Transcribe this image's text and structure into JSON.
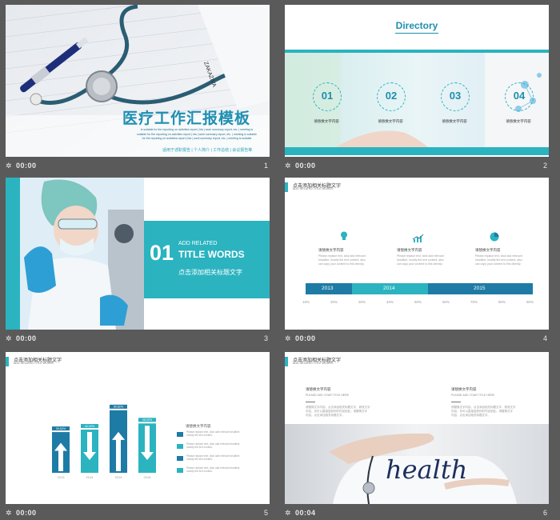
{
  "slides": [
    {
      "index": "1",
      "time": "00:00",
      "title": "医疗工作汇报模板",
      "desc": [
        "is suitable for the reporting on activities report | bla | work summary report, etc. | meeting is",
        "suitable for the reporting on activities report | bla | work summary report, etc. | meeting is suitable",
        "for the reporting on activities report | bla | work summary report, etc. | meeting is suitable"
      ],
      "subtitle": "适用于述职报告 | 个人简介 | 工作总结 | 会议报告等",
      "paper_text": "ZAKAZIVA"
    },
    {
      "index": "2",
      "time": "00:00",
      "title": "Directory",
      "items": [
        {
          "num": "01",
          "label": "请替换文字内容"
        },
        {
          "num": "02",
          "label": "请替换文字内容"
        },
        {
          "num": "03",
          "label": "请替换文字内容"
        },
        {
          "num": "04",
          "label": "请替换文字内容"
        }
      ]
    },
    {
      "index": "3",
      "time": "00:00",
      "number": "01",
      "add_related": "ADD RELATED",
      "title_words": "TITLE WORDS",
      "cn_title": "点击添加相关标题文字"
    },
    {
      "index": "4",
      "time": "00:00",
      "header": "点击添加相关标题文字",
      "subheader": "ADD RELATED TITLE WORDS",
      "icons": [
        {
          "icon": "lightbulb-icon",
          "label": "请替换文字内容"
        },
        {
          "icon": "trend-chart-icon",
          "label": "请替换文字内容"
        },
        {
          "icon": "pie-chart-icon",
          "label": "请替换文字内容"
        }
      ],
      "desc": [
        "Please replace text, click add relevant",
        "headline, modify the text content, also",
        "can copy your content to this directly."
      ],
      "timeline": [
        "2013",
        "2014",
        "2015"
      ],
      "percents": [
        "10%",
        "20%",
        "30%",
        "40%",
        "50%",
        "60%",
        "70%",
        "80%",
        "90%"
      ]
    },
    {
      "index": "5",
      "time": "00:00",
      "header": "点击添加相关标题文字",
      "subheader": "ADD RELATED TITLE WORDS",
      "legend_title": "请替换文字内容",
      "legend_items": [
        "Please replace text, click add relevant headline, modify the text content.",
        "Please replace text, click add relevant headline, modify the text content.",
        "Please replace text, click add relevant headline, modify the text content.",
        "Please replace text, click add relevant headline, modify the text content."
      ]
    },
    {
      "index": "6",
      "time": "00:04",
      "header": "点击添加相关标题文字",
      "subheader": "ADD RELATED TITLE WORDS",
      "col_title": "请替换文字内容",
      "col_sub": "PLEASE ADD YOUR TITLE HERE",
      "col_body": [
        "请替换文字内容，点击添加相关标题文字，修改文字",
        "内容，也可以直接复制你的内容到此。请替换文字",
        "内容，点击添加相关标题文字。"
      ],
      "photo_word": "health"
    }
  ],
  "chart_data": {
    "type": "bar",
    "categories": [
      "2013",
      "2014",
      "2015",
      "2016"
    ],
    "values": [
      39.6,
      42.0,
      60.8,
      48.0
    ],
    "data_labels": [
      "39.62%",
      "42.02%",
      "60.82%",
      "48.02%"
    ]
  }
}
